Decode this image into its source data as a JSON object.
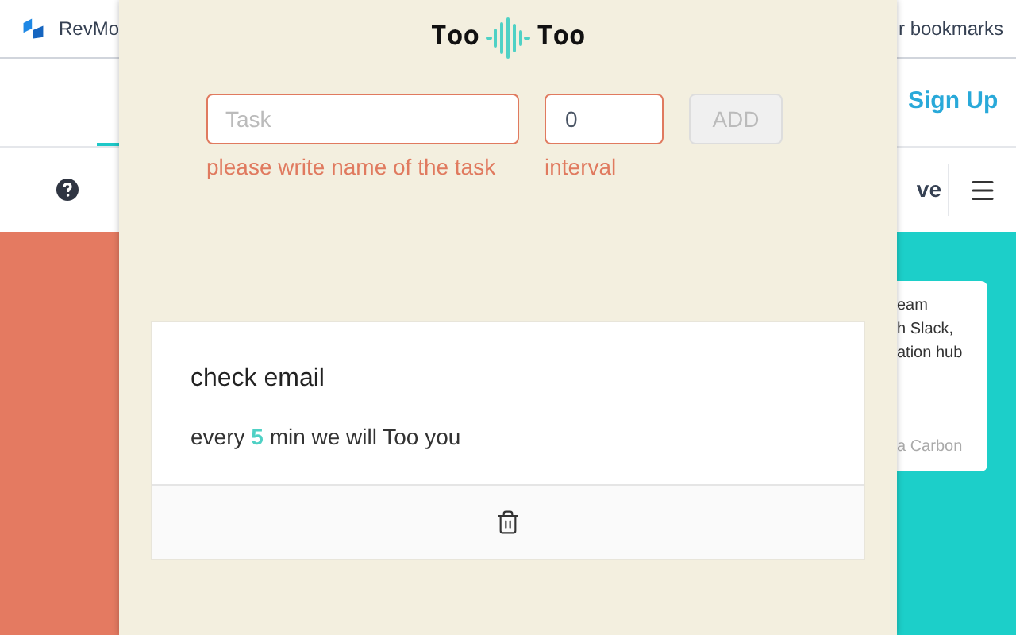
{
  "background_page": {
    "bookmarks_bar": {
      "site": "RevMo",
      "other": "r bookmarks"
    },
    "nav": {
      "sign_up": "Sign Up"
    },
    "toolbar": {
      "item": "ve"
    },
    "card": {
      "lines": [
        "eam",
        "h Slack,",
        "ation hub"
      ],
      "footer": "a Carbon"
    }
  },
  "popup": {
    "logo": {
      "left": "Too",
      "right": "Too"
    },
    "form": {
      "task": {
        "placeholder": "Task",
        "error": "please write name of the task"
      },
      "interval": {
        "value": "0",
        "label": "interval"
      },
      "add_button": {
        "label": "ADD",
        "disabled": true
      }
    },
    "tasks": [
      {
        "name": "check email",
        "prefix": "every",
        "interval": "5",
        "suffix": "min we will Too you"
      }
    ]
  }
}
